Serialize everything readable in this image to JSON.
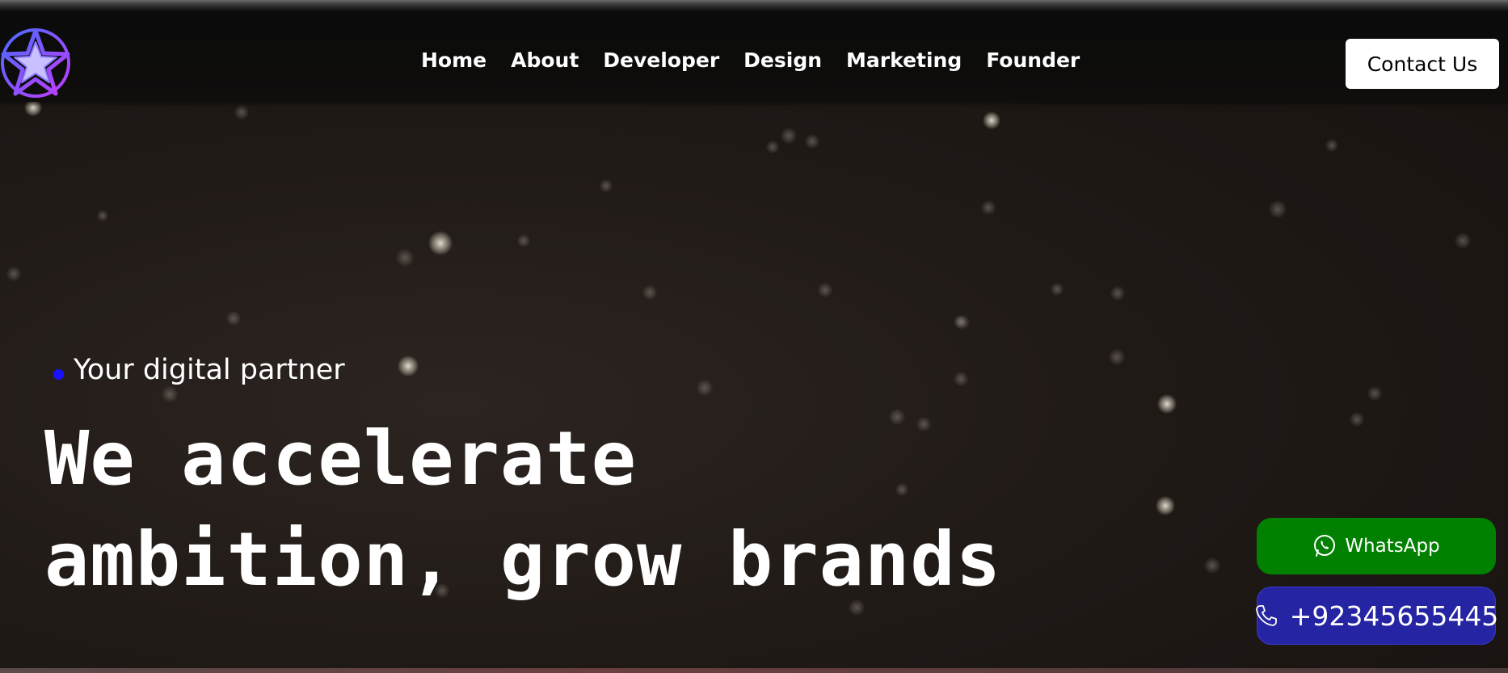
{
  "header": {
    "logo_icon": "star-logo-icon",
    "nav": [
      {
        "label": "Home"
      },
      {
        "label": "About"
      },
      {
        "label": "Developer"
      },
      {
        "label": "Design"
      },
      {
        "label": "Marketing"
      },
      {
        "label": "Founder"
      }
    ],
    "contact_label": "Contact Us"
  },
  "hero": {
    "eyebrow": "Your digital partner",
    "headline_line1": "We accelerate",
    "headline_line2": "ambition, grow brands"
  },
  "floating": {
    "whatsapp_label": "WhatsApp",
    "whatsapp_icon": "whatsapp-icon",
    "phone_label": "+92345655445",
    "phone_icon": "phone-icon"
  },
  "colors": {
    "whatsapp_bg": "#018001",
    "phone_bg": "#2525a3",
    "eyebrow_dot": "#1a12ff",
    "logo_outer": "#7a3cff",
    "logo_star": "#c9c0ff"
  }
}
